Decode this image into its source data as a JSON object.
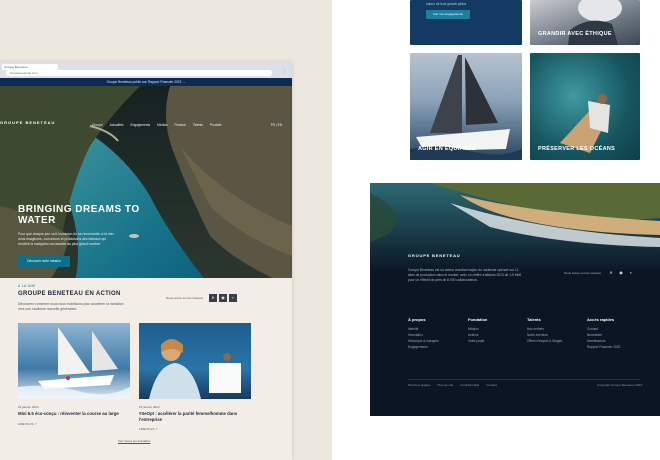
{
  "right_tiles": {
    "top_button": "Voir nos engagements",
    "tile_top_text": "autour de trois grands piliers",
    "grandir": "GRANDIR AVEC ÉTHIQUE",
    "agir": "AGIR EN ÉQUIPAGE",
    "preserver": "PRÉSERVER LES OCÉANS"
  },
  "browser": {
    "tab_title": "Groupe Beneteau",
    "url": "beneteau-group.com",
    "announcement": "Groupe Beneteau publie son Rapport Financier 2023  →"
  },
  "header": {
    "brand": "GROUPE BENETEAU",
    "nav": [
      "Groupe",
      "Actualités",
      "Engagements",
      "Médias",
      "Finance",
      "Talents",
      "Produits"
    ],
    "lang": "FR | EN"
  },
  "hero": {
    "title": "BRINGING DREAMS TO WATER",
    "lead": "Pour que chaque jour soit l'occasion de se reconnecter à la mer, nous imaginons, concevons et produisons des bateaux qui rendent la navigation accessible au plus grand nombre.",
    "cta": "Découvrir notre mission"
  },
  "news": {
    "eyebrow": "À LA UNE",
    "title": "GROUPE BENETEAU EN ACTION",
    "lead": "Découvrez comment nous nous mobilisons pour accélérer la transition vers une nautisme nouvelle génération.",
    "follow": "Nous suivre sur les réseaux",
    "cards": [
      {
        "date": "31 janvier 2024",
        "title": "Mini 6.5 éco-conçu : réinventer la course au large",
        "link": "LIRE PLUS"
      },
      {
        "date": "15 janvier 2024",
        "title": "#SeOpt : accélérer la parité femme/homme dans l'entreprise",
        "link": "LIRE PLUS"
      }
    ],
    "all": "Voir toutes les actualités"
  },
  "footer": {
    "brand": "GROUPE BENETEAU",
    "description": "Groupe Beneteau est un acteur mondial majeur du nautisme opérant sur 12 sites de production dans le monde, avec un chiffre d'affaires 2023 de 1,5 Md€ pour un effectif de près de 8 000 collaborateurs.",
    "follow": "Nous suivre sur les réseaux",
    "columns": [
      {
        "title": "À propos",
        "items": [
          "Identité",
          "Innovation",
          "Historique & marques",
          "Engagements"
        ]
      },
      {
        "title": "Fondation",
        "items": [
          "Mission",
          "Actions",
          "Votre projet"
        ]
      },
      {
        "title": "Talents",
        "items": [
          "Nos métiers",
          "Notre aventure",
          "Offres d'emploi & Stages"
        ]
      },
      {
        "title": "Accès rapides",
        "items": [
          "Contact",
          "Newsletter",
          "Investisseurs",
          "Rapport Financier 2023"
        ]
      }
    ],
    "legal": [
      "Mentions légales",
      "Plan du site",
      "Confidentialité",
      "Cookies"
    ],
    "copyright": "Copyright Groupe Beneteau 2024"
  },
  "colors": {
    "background": "#ede8df",
    "navy": "#0d2a52",
    "footer": "#0b1524",
    "accent": "#0e6f8a"
  }
}
